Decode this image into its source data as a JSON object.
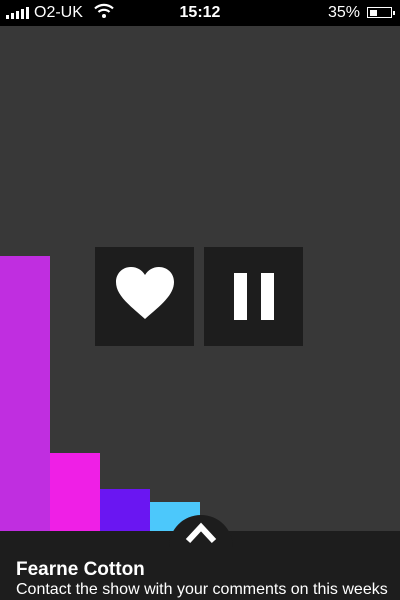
{
  "status_bar": {
    "carrier": "O2-UK",
    "time": "15:12",
    "battery_percent": "35%",
    "battery_level": 0.35,
    "signal_icon": "signal-bars-icon",
    "wifi_icon": "wifi-icon"
  },
  "visualizer": {
    "bars": [
      {
        "color": "#c02ee0"
      },
      {
        "color": "#ef1fe6"
      },
      {
        "color": "#6a16f2"
      },
      {
        "color": "#4cc8fb"
      }
    ]
  },
  "controls": {
    "like_icon": "heart-icon",
    "pause_icon": "pause-icon"
  },
  "now_playing": {
    "title": "Fearne Cotton",
    "description": "Contact the show with your comments on this weeks",
    "expand_icon": "chevron-up-icon"
  },
  "colors": {
    "background": "#383838",
    "panel": "#1d1d1d",
    "status_bar": "#000000"
  }
}
